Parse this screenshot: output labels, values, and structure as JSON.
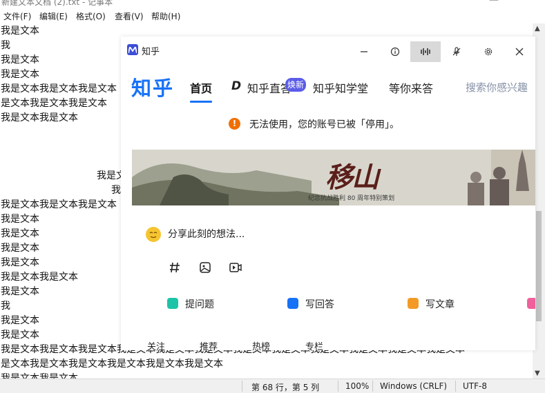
{
  "notepad": {
    "title": "新建文本文档 (2).txt - 记事本",
    "menu": [
      "文件(F)",
      "编辑(E)",
      "格式(O)",
      "查看(V)",
      "帮助(H)"
    ],
    "lines": [
      "我是文本",
      "我",
      "我是文本",
      "我是文本",
      "我是文本我是文本我是文本",
      "是文本我是文本我是文本",
      "我是文本我是文本",
      "",
      "",
      "我是文本",
      "我",
      "我是文本我是文本我是文本",
      "我是文本",
      "我是文本",
      "我是文本",
      "我是文本",
      "我是文本我是文本",
      "我是文本",
      "我",
      "我是文本",
      "我是文本",
      "我是文本我是文本我是文本我是文本我是文本我是文本我是文本我是文本我是文本我是文本我是文本我是文本",
      "是文本我是文本我是文本我是文本我是文本我是文本",
      "我是文本我是文本"
    ],
    "status": {
      "position": "第 68 行，第 5 列",
      "zoom": "100%",
      "line_ending": "Windows (CRLF)",
      "encoding": "UTF-8"
    }
  },
  "zhihu": {
    "window_title": "知乎",
    "brand": "知乎",
    "nav": [
      "首页",
      "知乎直答",
      "知乎知学堂",
      "等你来答"
    ],
    "badge": "焕新",
    "search_placeholder": "搜索你感兴趣",
    "notice": "无法使用，您的账号已被「停用」。",
    "banner": {
      "title": "移山",
      "caption": "纪念抗战胜利 80 周年特别策划"
    },
    "share_placeholder": "分享此刻的想法...",
    "tools": [
      "hash-icon",
      "image-icon",
      "video-icon"
    ],
    "actions": [
      {
        "label": "提问题",
        "color": "#1bc4a9"
      },
      {
        "label": "写回答",
        "color": "#1772f6"
      },
      {
        "label": "写文章",
        "color": "#f39a26"
      }
    ],
    "tabs": [
      "关注",
      "推荐",
      "热榜",
      "专栏"
    ],
    "colors": {
      "brand": "#1772f6",
      "notice": "#f06f00",
      "badge": "#5b5ce8"
    }
  }
}
